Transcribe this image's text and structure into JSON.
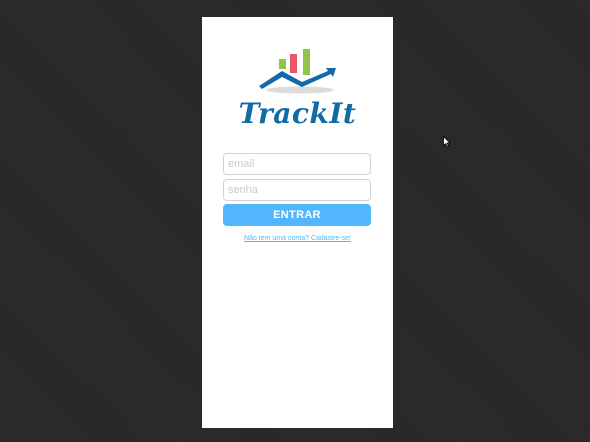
{
  "app": {
    "brand_name": "TrackIt",
    "logo_icon": "chart-arrow-icon",
    "colors": {
      "brand": "#126BA5",
      "accent": "#52B6FF",
      "bar_green": "#8FC549",
      "bar_red": "#E75766"
    }
  },
  "login": {
    "email_placeholder": "email",
    "password_placeholder": "senha",
    "submit_label": "ENTRAR",
    "signup_link": "Não tem uma conta? Cadastre-se!"
  }
}
